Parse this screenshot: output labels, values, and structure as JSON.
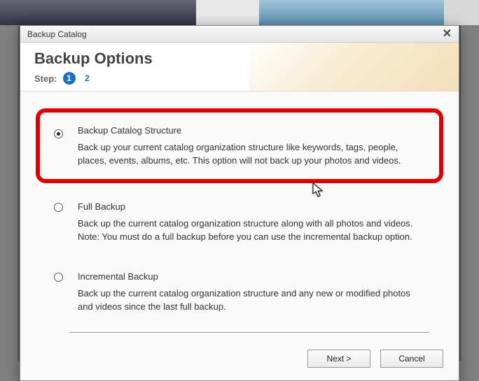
{
  "window": {
    "title": "Backup Catalog"
  },
  "header": {
    "heading": "Backup Options",
    "step_label": "Step:",
    "step_current": "1",
    "step_next": "2"
  },
  "options": [
    {
      "title": "Backup Catalog Structure",
      "desc": "Back up your current catalog organization structure like keywords, tags, people, places, events, albums, etc. This option will not back up your photos and videos.",
      "selected": true,
      "highlighted": true
    },
    {
      "title": "Full Backup",
      "desc": "Back up the current catalog organization structure along with all photos and videos. Note: You must do a full backup before you can use the incremental backup option.",
      "selected": false,
      "highlighted": false
    },
    {
      "title": "Incremental Backup",
      "desc": "Back up the current catalog organization structure and any new or modified photos and videos since the last full backup.",
      "selected": false,
      "highlighted": false
    }
  ],
  "footer": {
    "next_label": "Next >",
    "cancel_label": "Cancel"
  }
}
